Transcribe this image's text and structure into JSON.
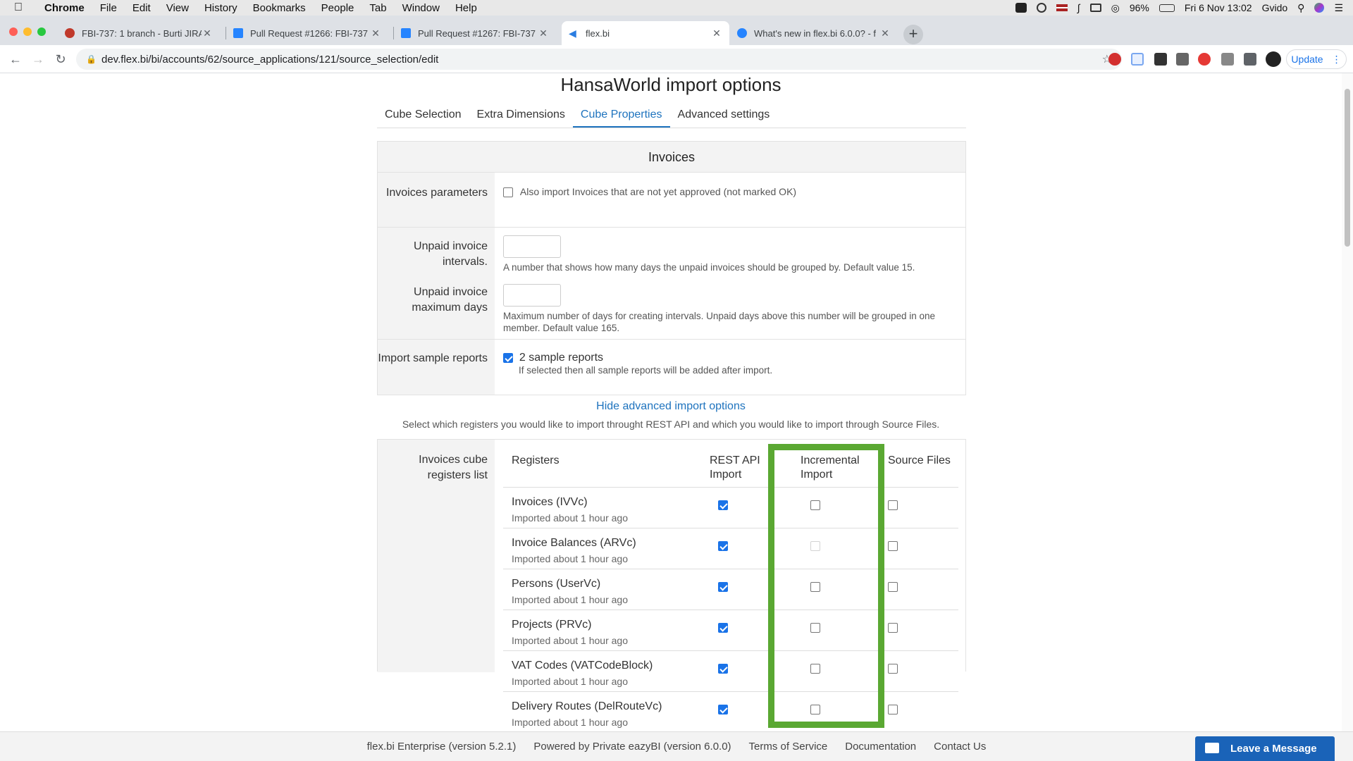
{
  "menubar": {
    "app": "Chrome",
    "items": [
      "File",
      "Edit",
      "View",
      "History",
      "Bookmarks",
      "People",
      "Tab",
      "Window",
      "Help"
    ],
    "battery": "96%",
    "datetime": "Fri 6 Nov  13:02",
    "user": "Gvido"
  },
  "tabs": [
    {
      "title": "FBI-737: 1 branch - Burti JIRA",
      "favicon": "jira-icon",
      "active": false
    },
    {
      "title": "Pull Request #1266: FBI-737 - ...",
      "favicon": "bitbucket-icon",
      "active": false
    },
    {
      "title": "Pull Request #1267: FBI-737 - ...",
      "favicon": "bitbucket-icon",
      "active": false
    },
    {
      "title": "flex.bi",
      "favicon": "flexbi-icon",
      "active": true
    },
    {
      "title": "What's new in flex.bi 6.0.0? - f",
      "favicon": "confluence-icon",
      "active": false
    }
  ],
  "toolbar": {
    "url": "dev.flex.bi/bi/accounts/62/source_applications/121/source_selection/edit",
    "update_label": "Update"
  },
  "page": {
    "title": "HansaWorld import options",
    "tabs": [
      "Cube Selection",
      "Extra Dimensions",
      "Cube Properties",
      "Advanced settings"
    ],
    "active_tab": "Cube Properties"
  },
  "invoices": {
    "heading": "Invoices",
    "params_label": "Invoices parameters",
    "params_checkbox": "Also import Invoices that are not yet approved (not marked OK)",
    "unpaid_intervals_label": "Unpaid invoice intervals.",
    "unpaid_intervals_help": "A number that shows how many days the unpaid invoices should be grouped by. Default value 15.",
    "unpaid_max_label": "Unpaid invoice maximum days",
    "unpaid_max_help": "Maximum number of days for creating intervals. Unpaid days above this number will be grouped in one member. Default value 165.",
    "sample_label": "Import sample reports",
    "sample_checkbox": "2 sample reports",
    "sample_help": "If selected then all sample reports will be added after import."
  },
  "advanced": {
    "toggle_link": "Hide advanced import options",
    "description": "Select which registers you would like to import throught REST API and which you would like to import through Source Files."
  },
  "registers": {
    "label": "Invoices cube registers list",
    "headers": {
      "name": "Registers",
      "rest": "REST API Import",
      "incremental": "Incremental Import",
      "source": "Source Files"
    },
    "rows": [
      {
        "name": "Invoices (IVVc)",
        "status": "Imported about 1 hour ago",
        "rest": true,
        "incremental": false,
        "incremental_disabled": false,
        "source": false
      },
      {
        "name": "Invoice Balances (ARVc)",
        "status": "Imported about 1 hour ago",
        "rest": true,
        "incremental": false,
        "incremental_disabled": true,
        "source": false
      },
      {
        "name": "Persons (UserVc)",
        "status": "Imported about 1 hour ago",
        "rest": true,
        "incremental": false,
        "incremental_disabled": false,
        "source": false
      },
      {
        "name": "Projects (PRVc)",
        "status": "Imported about 1 hour ago",
        "rest": true,
        "incremental": false,
        "incremental_disabled": false,
        "source": false
      },
      {
        "name": "VAT Codes (VATCodeBlock)",
        "status": "Imported about 1 hour ago",
        "rest": true,
        "incremental": false,
        "incremental_disabled": false,
        "source": false
      },
      {
        "name": "Delivery Routes (DelRouteVc)",
        "status": "Imported about 1 hour ago",
        "rest": true,
        "incremental": false,
        "incremental_disabled": false,
        "source": false
      }
    ]
  },
  "footer": {
    "edition": "flex.bi Enterprise (version 5.2.1)",
    "powered": "Powered by Private eazyBI (version 6.0.0)",
    "terms": "Terms of Service",
    "docs": "Documentation",
    "contact": "Contact Us"
  },
  "chat": {
    "label": "Leave a Message"
  },
  "colors": {
    "highlight": "#5aa832",
    "link": "#1e73be",
    "checkbox": "#1a73e8",
    "chat": "#1a63b8"
  }
}
